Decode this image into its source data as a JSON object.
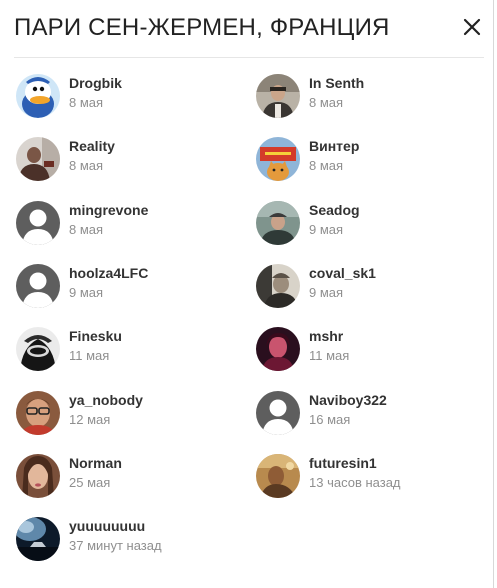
{
  "modal": {
    "title": "ПАРИ СЕН-ЖЕРМЕН, ФРАНЦИЯ",
    "close_icon": "close-icon"
  },
  "users": [
    {
      "name": "Drogbik",
      "time": "8 мая",
      "avatar": "donald-duck-avatar"
    },
    {
      "name": "In Senth",
      "time": "8 мая",
      "avatar": "photo-avatar"
    },
    {
      "name": "Reality",
      "time": "8 мая",
      "avatar": "photo-avatar"
    },
    {
      "name": "Винтер",
      "time": "8 мая",
      "avatar": "cat-sign-avatar"
    },
    {
      "name": "mingrevone",
      "time": "8 мая",
      "avatar": "default-avatar"
    },
    {
      "name": "Seadog",
      "time": "9 мая",
      "avatar": "photo-avatar"
    },
    {
      "name": "hoolza4LFC",
      "time": "9 мая",
      "avatar": "default-avatar"
    },
    {
      "name": "coval_sk1",
      "time": "9 мая",
      "avatar": "photo-avatar"
    },
    {
      "name": "Finesku",
      "time": "11 мая",
      "avatar": "masked-figure-avatar"
    },
    {
      "name": "mshr",
      "time": "11 мая",
      "avatar": "photo-avatar"
    },
    {
      "name": "ya_nobody",
      "time": "12 мая",
      "avatar": "photo-avatar"
    },
    {
      "name": "Naviboy322",
      "time": "16 мая",
      "avatar": "default-avatar"
    },
    {
      "name": "Norman",
      "time": "25 мая",
      "avatar": "photo-avatar"
    },
    {
      "name": "futuresin1",
      "time": "13 часов назад",
      "avatar": "photo-avatar"
    },
    {
      "name": "yuuuuuuuu",
      "time": "37 минут назад",
      "avatar": "photo-avatar"
    }
  ]
}
